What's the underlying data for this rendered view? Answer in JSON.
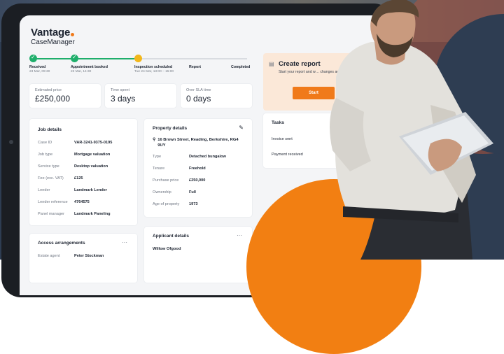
{
  "app": {
    "brand": "Vantage",
    "product": "CaseManager"
  },
  "steps": [
    {
      "label": "Received",
      "date": "23 Mar, 09:30",
      "state": "done"
    },
    {
      "label": "Appointment booked",
      "date": "23 Mar, 14:30",
      "state": "done"
    },
    {
      "label": "Inspection scheduled",
      "date": "Tue 24 Mar, 13:00 – 15:00",
      "state": "current"
    },
    {
      "label": "Report",
      "date": "",
      "state": "todo"
    },
    {
      "label": "Completed",
      "date": "",
      "state": "todo"
    }
  ],
  "stats": [
    {
      "label": "Estimated price",
      "value": "£250,000"
    },
    {
      "label": "Time spent",
      "value": "3 days"
    },
    {
      "label": "Over SLA time",
      "value": "0 days"
    }
  ],
  "job_details": {
    "title": "Job details",
    "rows": [
      {
        "k": "Case ID",
        "v": "VAR-3241-9375-0195"
      },
      {
        "k": "Job type",
        "v": "Mortgage valuation"
      },
      {
        "k": "Service type",
        "v": "Desktop valuation"
      },
      {
        "k": "Fee (exc. VAT)",
        "v": "£125"
      },
      {
        "k": "Lender",
        "v": "Landmark Lender"
      },
      {
        "k": "Lender reference",
        "v": "4764575"
      },
      {
        "k": "Panel manager",
        "v": "Landmark Paneling"
      }
    ]
  },
  "property_details": {
    "title": "Property details",
    "address": "16 Brown Street, Reading, Berkshire, RG4 9UY",
    "rows": [
      {
        "k": "Type",
        "v": "Detached bungalow"
      },
      {
        "k": "Tenure",
        "v": "Freehold"
      },
      {
        "k": "Purchase price",
        "v": "£250,000"
      },
      {
        "k": "Ownership",
        "v": "Full"
      },
      {
        "k": "Age of property",
        "v": "1973"
      }
    ]
  },
  "access": {
    "title": "Access arrangements",
    "menu": "···",
    "row_k": "Estate agent",
    "row_v": "Peter Stockman"
  },
  "applicant": {
    "title": "Applicant details",
    "menu": "···",
    "name": "Willow Ofgood"
  },
  "create_report": {
    "title": "Create report",
    "desc": "Start your report and w… changes automatical…",
    "button": "Start"
  },
  "tasks": {
    "title": "Tasks",
    "items": [
      "Invoice sent",
      "Payment received"
    ]
  },
  "colors": {
    "accent": "#f07a1a",
    "done": "#1fae6b",
    "current": "#f2b71b",
    "background": "#2e3d52"
  }
}
